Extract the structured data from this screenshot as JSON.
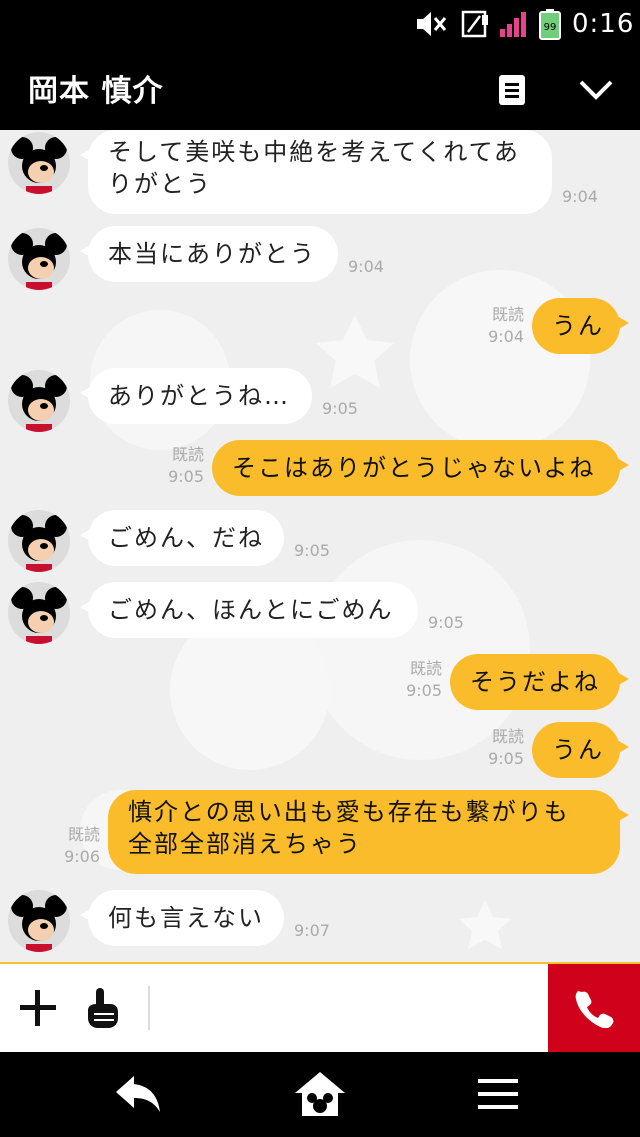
{
  "status_bar": {
    "time": "0:16",
    "battery": "99"
  },
  "header": {
    "contact_name": "岡本 慎介"
  },
  "messages": [
    {
      "dir": "in",
      "lines": [
        "そして美咲も中絶を考えてくれてあ",
        "りがとう"
      ],
      "time": "9:04"
    },
    {
      "dir": "in",
      "lines": [
        "本当にありがとう"
      ],
      "time": "9:04"
    },
    {
      "dir": "out",
      "lines": [
        "うん"
      ],
      "read": "既読",
      "time": "9:04"
    },
    {
      "dir": "in",
      "lines": [
        "ありがとうね…"
      ],
      "time": "9:05"
    },
    {
      "dir": "out",
      "lines": [
        "そこはありがとうじゃないよね"
      ],
      "read": "既読",
      "time": "9:05"
    },
    {
      "dir": "in",
      "lines": [
        "ごめん、だね"
      ],
      "time": "9:05"
    },
    {
      "dir": "in",
      "lines": [
        "ごめん、ほんとにごめん"
      ],
      "time": "9:05"
    },
    {
      "dir": "out",
      "lines": [
        "そうだよね"
      ],
      "read": "既読",
      "time": "9:05"
    },
    {
      "dir": "out",
      "lines": [
        "うん"
      ],
      "read": "既読",
      "time": "9:05"
    },
    {
      "dir": "out",
      "lines": [
        "慎介との思い出も愛も存在も繋がりも",
        "全部全部消えちゃう"
      ],
      "read": "既読",
      "time": "9:06"
    },
    {
      "dir": "in",
      "lines": [
        "何も言えない"
      ],
      "time": "9:07"
    }
  ],
  "composer": {
    "value": ""
  },
  "colors": {
    "outgoing_bubble": "#fbbc2b",
    "call_button": "#d0021b",
    "chat_background": "#efefef"
  }
}
